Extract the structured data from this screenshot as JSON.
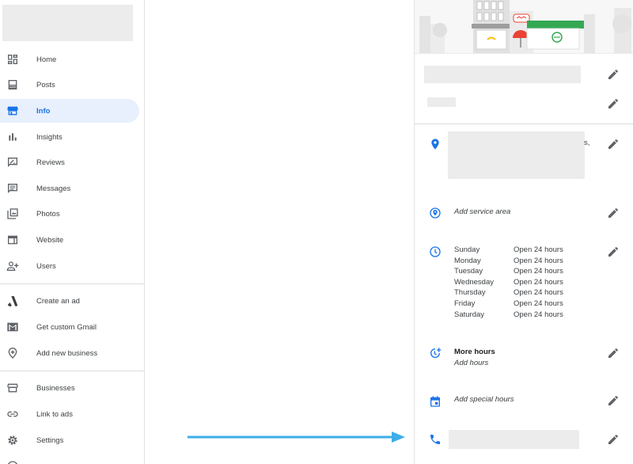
{
  "sidebar": {
    "items": [
      {
        "label": "Home",
        "icon": "dashboard-icon"
      },
      {
        "label": "Posts",
        "icon": "posts-icon"
      },
      {
        "label": "Info",
        "icon": "storefront-icon",
        "active": true
      },
      {
        "label": "Insights",
        "icon": "bar-chart-icon"
      },
      {
        "label": "Reviews",
        "icon": "rate-review-icon"
      },
      {
        "label": "Messages",
        "icon": "message-icon"
      },
      {
        "label": "Photos",
        "icon": "photo-library-icon"
      },
      {
        "label": "Website",
        "icon": "web-icon"
      },
      {
        "label": "Users",
        "icon": "person-add-icon"
      }
    ],
    "secondary": [
      {
        "label": "Create an ad",
        "icon": "google-ads-icon"
      },
      {
        "label": "Get custom Gmail",
        "icon": "gmail-icon"
      },
      {
        "label": "Add new business",
        "icon": "add-location-icon"
      }
    ],
    "tertiary": [
      {
        "label": "Businesses",
        "icon": "store-icon"
      },
      {
        "label": "Link to ads",
        "icon": "link-icon"
      },
      {
        "label": "Settings",
        "icon": "settings-icon"
      }
    ]
  },
  "info": {
    "address_fragment": "s,",
    "service_area_placeholder": "Add service area",
    "hours": [
      {
        "day": "Sunday",
        "value": "Open 24 hours"
      },
      {
        "day": "Monday",
        "value": "Open 24 hours"
      },
      {
        "day": "Tuesday",
        "value": "Open 24 hours"
      },
      {
        "day": "Wednesday",
        "value": "Open 24 hours"
      },
      {
        "day": "Thursday",
        "value": "Open 24 hours"
      },
      {
        "day": "Friday",
        "value": "Open 24 hours"
      },
      {
        "day": "Saturday",
        "value": "Open 24 hours"
      }
    ],
    "more_hours_title": "More hours",
    "more_hours_placeholder": "Add hours",
    "special_hours_placeholder": "Add special hours"
  },
  "colors": {
    "accent": "#1a73e8",
    "active_bg": "#e8f0fe",
    "arrow": "#3daee9",
    "icon_gray": "#5f6368"
  }
}
